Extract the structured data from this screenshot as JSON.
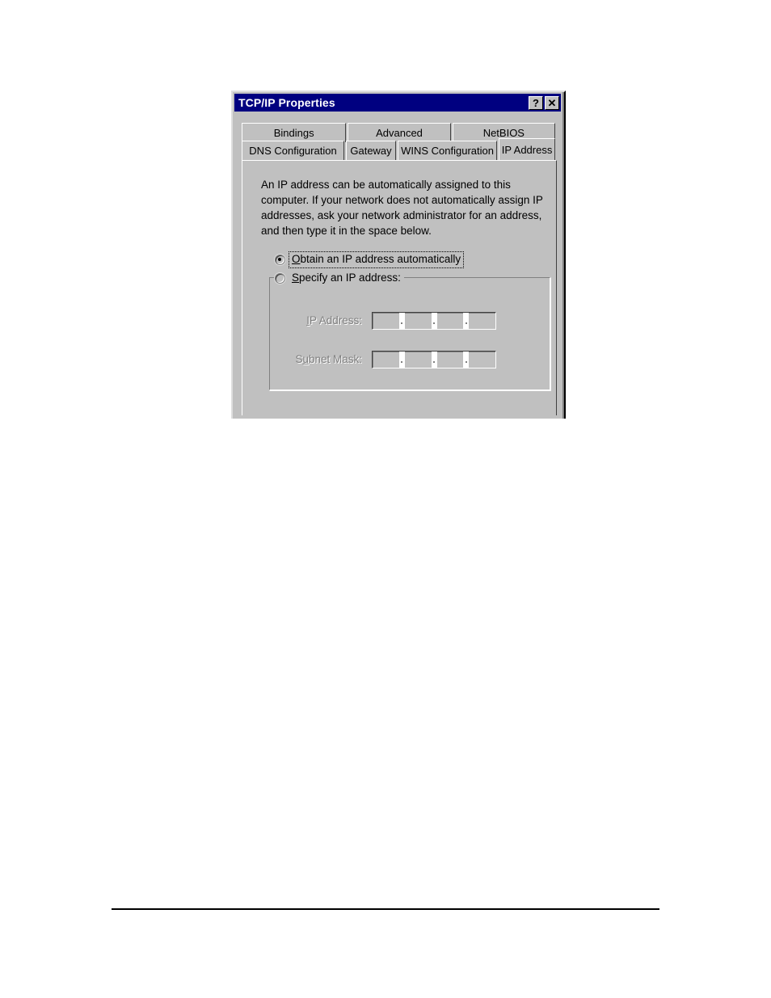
{
  "dialog": {
    "title": "TCP/IP Properties",
    "titlebar_buttons": [
      {
        "name": "help-button",
        "glyph": "?"
      },
      {
        "name": "close-button",
        "glyph": "✕"
      }
    ],
    "tabs_row_top": [
      {
        "label": "Bindings",
        "selected": false
      },
      {
        "label": "Advanced",
        "selected": false
      },
      {
        "label": "NetBIOS",
        "selected": false
      }
    ],
    "tabs_row_bottom": [
      {
        "label": "DNS Configuration",
        "selected": false
      },
      {
        "label": "Gateway",
        "selected": false
      },
      {
        "label": "WINS Configuration",
        "selected": false
      },
      {
        "label": "IP Address",
        "selected": true
      }
    ],
    "description": "An IP address can be automatically assigned to this computer. If your network does not automatically assign IP addresses, ask your network administrator for an address, and then type it in the space below.",
    "radio_obtain": {
      "label_accel": "O",
      "label_rest": "btain an IP address automatically",
      "checked": true,
      "focused": true
    },
    "radio_specify": {
      "label_accel": "S",
      "label_rest": "pecify an IP address:",
      "checked": false,
      "focused": false
    },
    "fields": [
      {
        "name": "ip-address",
        "label_accel": "I",
        "label_rest": "P Address:",
        "disabled": true,
        "octets": [
          "",
          "",
          "",
          ""
        ],
        "separator": "."
      },
      {
        "name": "subnet-mask",
        "label_pre": "S",
        "label_accel": "u",
        "label_rest": "bnet Mask:",
        "disabled": true,
        "octets": [
          "",
          "",
          "",
          ""
        ],
        "separator": "."
      }
    ],
    "colors": {
      "titlebar": "#000080",
      "titlebar_text": "#ffffff",
      "face": "#c0c0c0",
      "shadow": "#808080",
      "highlight": "#ffffff",
      "dark": "#404040",
      "text": "#000000",
      "disabled_text": "#808080"
    }
  }
}
